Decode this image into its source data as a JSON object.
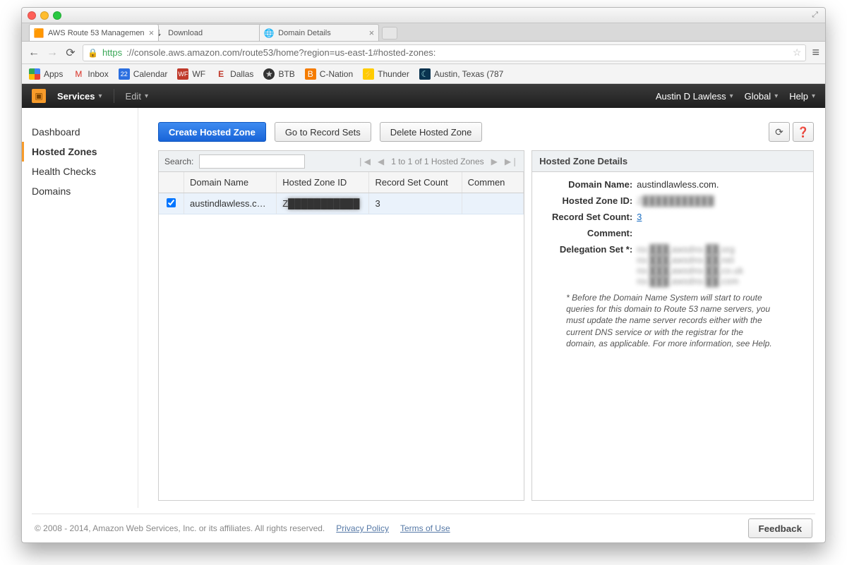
{
  "browser": {
    "tabs": [
      {
        "title": "AWS Route 53 Managemen",
        "active": true
      },
      {
        "title": "Download",
        "active": false
      },
      {
        "title": "Domain Details",
        "active": false
      }
    ],
    "url_https": "https",
    "url_path": "://console.aws.amazon.com/route53/home?region=us-east-1#hosted-zones:",
    "bookmarks": {
      "apps": "Apps",
      "inbox": "Inbox",
      "calendar": "Calendar",
      "wf": "WF",
      "dallas": "Dallas",
      "btb": "BTB",
      "cnation": "C-Nation",
      "thunder": "Thunder",
      "austin": "Austin, Texas (787"
    }
  },
  "aws_nav": {
    "services": "Services",
    "edit": "Edit",
    "user": "Austin D Lawless",
    "region": "Global",
    "help": "Help"
  },
  "sidebar": {
    "items": [
      {
        "label": "Dashboard"
      },
      {
        "label": "Hosted Zones"
      },
      {
        "label": "Health Checks"
      },
      {
        "label": "Domains"
      }
    ]
  },
  "toolbar": {
    "create": "Create Hosted Zone",
    "recordsets": "Go to Record Sets",
    "delete": "Delete Hosted Zone"
  },
  "table": {
    "search_label": "Search:",
    "pager_text": "1 to 1 of 1 Hosted Zones",
    "headers": {
      "domain": "Domain Name",
      "zoneid": "Hosted Zone ID",
      "count": "Record Set Count",
      "comment": "Commen"
    },
    "rows": [
      {
        "domain": "austindlawless.com.",
        "zoneid": "Z███████████",
        "count": "3",
        "comment": ""
      }
    ]
  },
  "details": {
    "title": "Hosted Zone Details",
    "labels": {
      "domain": "Domain Name:",
      "zoneid": "Hosted Zone ID:",
      "count": "Record Set Count:",
      "comment": "Comment:",
      "delegation": "Delegation Set *:"
    },
    "values": {
      "domain": "austindlawless.com.",
      "zoneid": "Z███████████",
      "count": "3",
      "comment": "",
      "delegation": [
        "ns-███.awsdns-██.org",
        "ns-███.awsdns-██.net",
        "ns-███.awsdns-██.co.uk",
        "ns-███.awsdns-██.com"
      ]
    },
    "note": "* Before the Domain Name System will start to route queries for this domain to Route 53 name servers, you must update the name server records either with the current DNS service or with the registrar for the domain, as applicable. For more information, see Help."
  },
  "footer": {
    "copyright": "© 2008 - 2014, Amazon Web Services, Inc. or its affiliates. All rights reserved.",
    "privacy": "Privacy Policy",
    "terms": "Terms of Use",
    "feedback": "Feedback"
  }
}
